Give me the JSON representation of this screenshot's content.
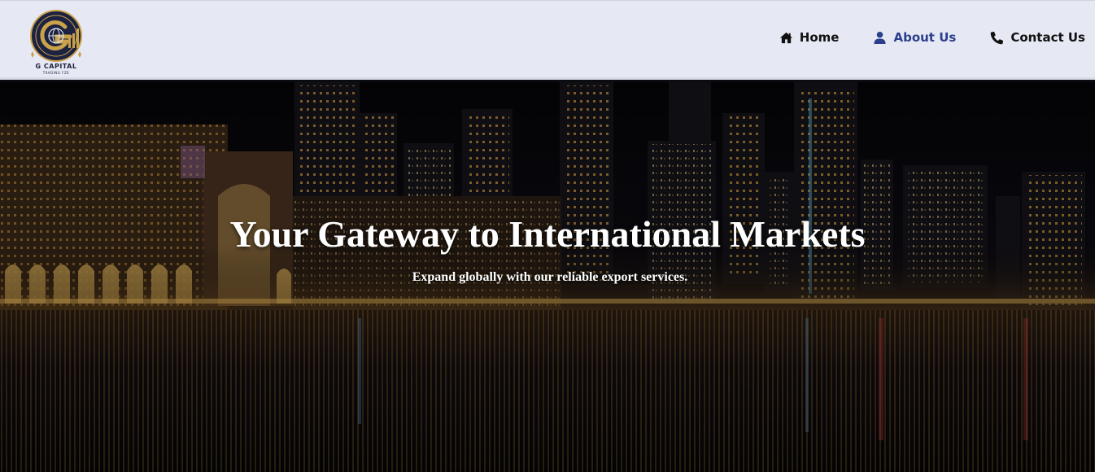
{
  "brand": {
    "name": "G CAPITAL",
    "tagline": "TRADING FZE",
    "colors": {
      "gold": "#c9a24a",
      "navy": "#1c2240"
    }
  },
  "nav": {
    "items": [
      {
        "label": "Home",
        "icon": "home-icon",
        "active": false
      },
      {
        "label": "About Us",
        "icon": "user-icon",
        "active": true
      },
      {
        "label": "Contact Us",
        "icon": "phone-icon",
        "active": false
      }
    ],
    "active_color": "#2b3f8c"
  },
  "hero": {
    "title": "Your Gateway to International Markets",
    "subtitle": "Expand globally with our reliable export services.",
    "background": "night-city-skyline-waterfront"
  }
}
